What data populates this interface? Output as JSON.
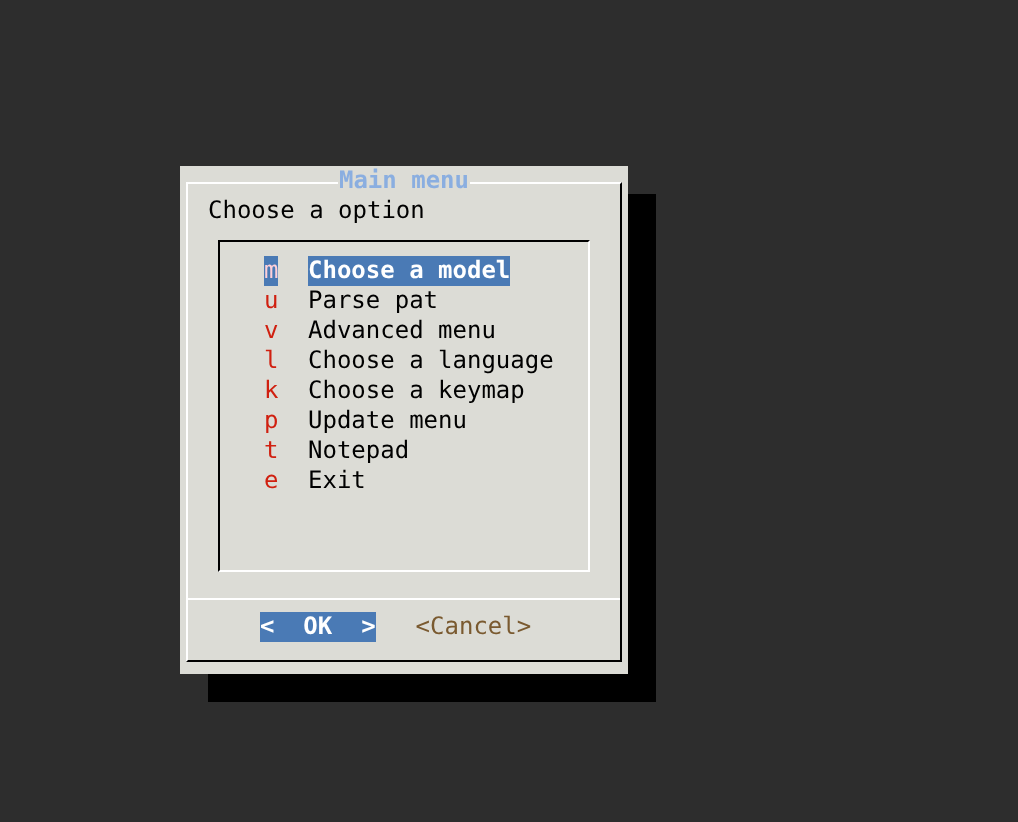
{
  "dialog": {
    "title": "Main menu",
    "prompt": "Choose a option"
  },
  "menu": [
    {
      "key": "m",
      "label": "Choose a model",
      "selected": true
    },
    {
      "key": "u",
      "label": "Parse pat",
      "selected": false
    },
    {
      "key": "v",
      "label": "Advanced menu",
      "selected": false
    },
    {
      "key": "l",
      "label": "Choose a language",
      "selected": false
    },
    {
      "key": "k",
      "label": "Choose a keymap",
      "selected": false
    },
    {
      "key": "p",
      "label": "Update menu",
      "selected": false
    },
    {
      "key": "t",
      "label": "Notepad",
      "selected": false
    },
    {
      "key": "e",
      "label": "Exit",
      "selected": false
    }
  ],
  "buttons": [
    {
      "label": "<  OK  >",
      "selected": true
    },
    {
      "label": "<Cancel>",
      "selected": false
    }
  ]
}
